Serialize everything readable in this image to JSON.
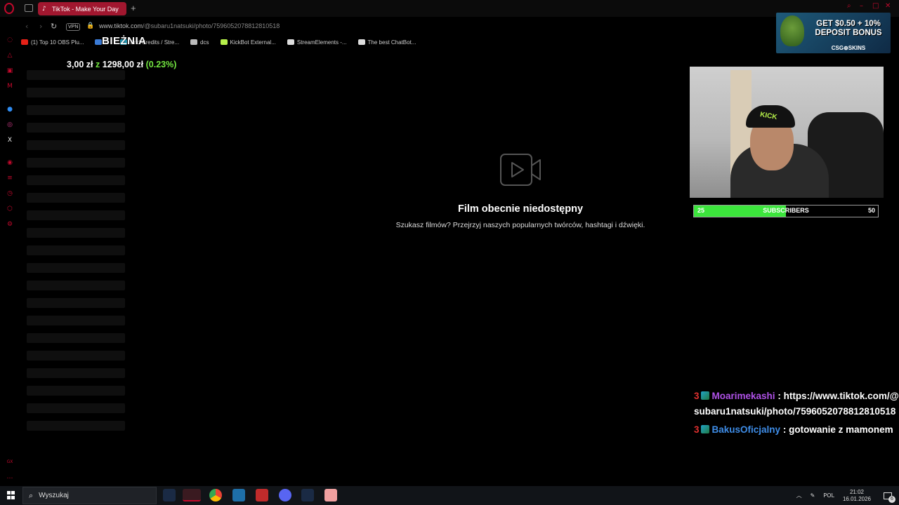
{
  "browser": {
    "tab_title": "TikTok - Make Your Day",
    "new_tab_symbol": "+",
    "vpn_label": "VPN",
    "url_domain": "www.tiktok.com",
    "url_path": "/@subaru1natsuki/photo/7596052078812810518"
  },
  "bookmarks": [
    {
      "label": "(1) Top 10 OBS Plu...",
      "icon": "youtube-icon",
      "color": "#e62117"
    },
    {
      "label": "C",
      "icon": "bookmark-icon",
      "color": "#3b7bd6"
    },
    {
      "label": "End Credits / Stre...",
      "icon": "streamelements-icon",
      "color": "#2bb5d6"
    },
    {
      "label": "dcs",
      "icon": "folder-icon",
      "color": "#bbbbbb"
    },
    {
      "label": "KickBot External...",
      "icon": "kickbot-icon",
      "color": "#b6f04a"
    },
    {
      "label": "StreamElements -...",
      "icon": "streamelements-icon",
      "color": "#dddddd"
    },
    {
      "label": "The best ChatBot...",
      "icon": "chatbot-icon",
      "color": "#dddddd"
    }
  ],
  "overlay": {
    "label": "BIEŻNIA",
    "donation_current": "3,00 zł",
    "donation_connector": "z",
    "donation_goal": "1298,00 zł",
    "donation_percent": "(0.23%)"
  },
  "main": {
    "title": "Film obecnie niedostępny",
    "subtitle": "Szukasz filmów? Przejrzyj naszych popularnych twórców, hashtagi i dźwięki."
  },
  "ad": {
    "headline": "GET $0.50 + 10% DEPOSIT BONUS",
    "brand": "CSG⊕SKINS"
  },
  "webcam": {
    "cap_text": "KICK"
  },
  "sub_goal": {
    "current": "25",
    "label": "SUBSCRIBERS",
    "target": "50",
    "progress": 0.5
  },
  "chat": [
    {
      "badge": "3",
      "user": "Moarimekashi",
      "separator": " :",
      "text": "https://www.tiktok.com/@subaru1natsuki/photo/7596052078812810518"
    },
    {
      "badge": "3",
      "user": "BakusOficjalny",
      "separator": " :",
      "text": "gotowanie z mamonem"
    }
  ],
  "taskbar": {
    "search_placeholder": "Wyszukaj",
    "language": "POL",
    "time": "21:02",
    "date": "16.01.2026",
    "notification_count": "6"
  }
}
